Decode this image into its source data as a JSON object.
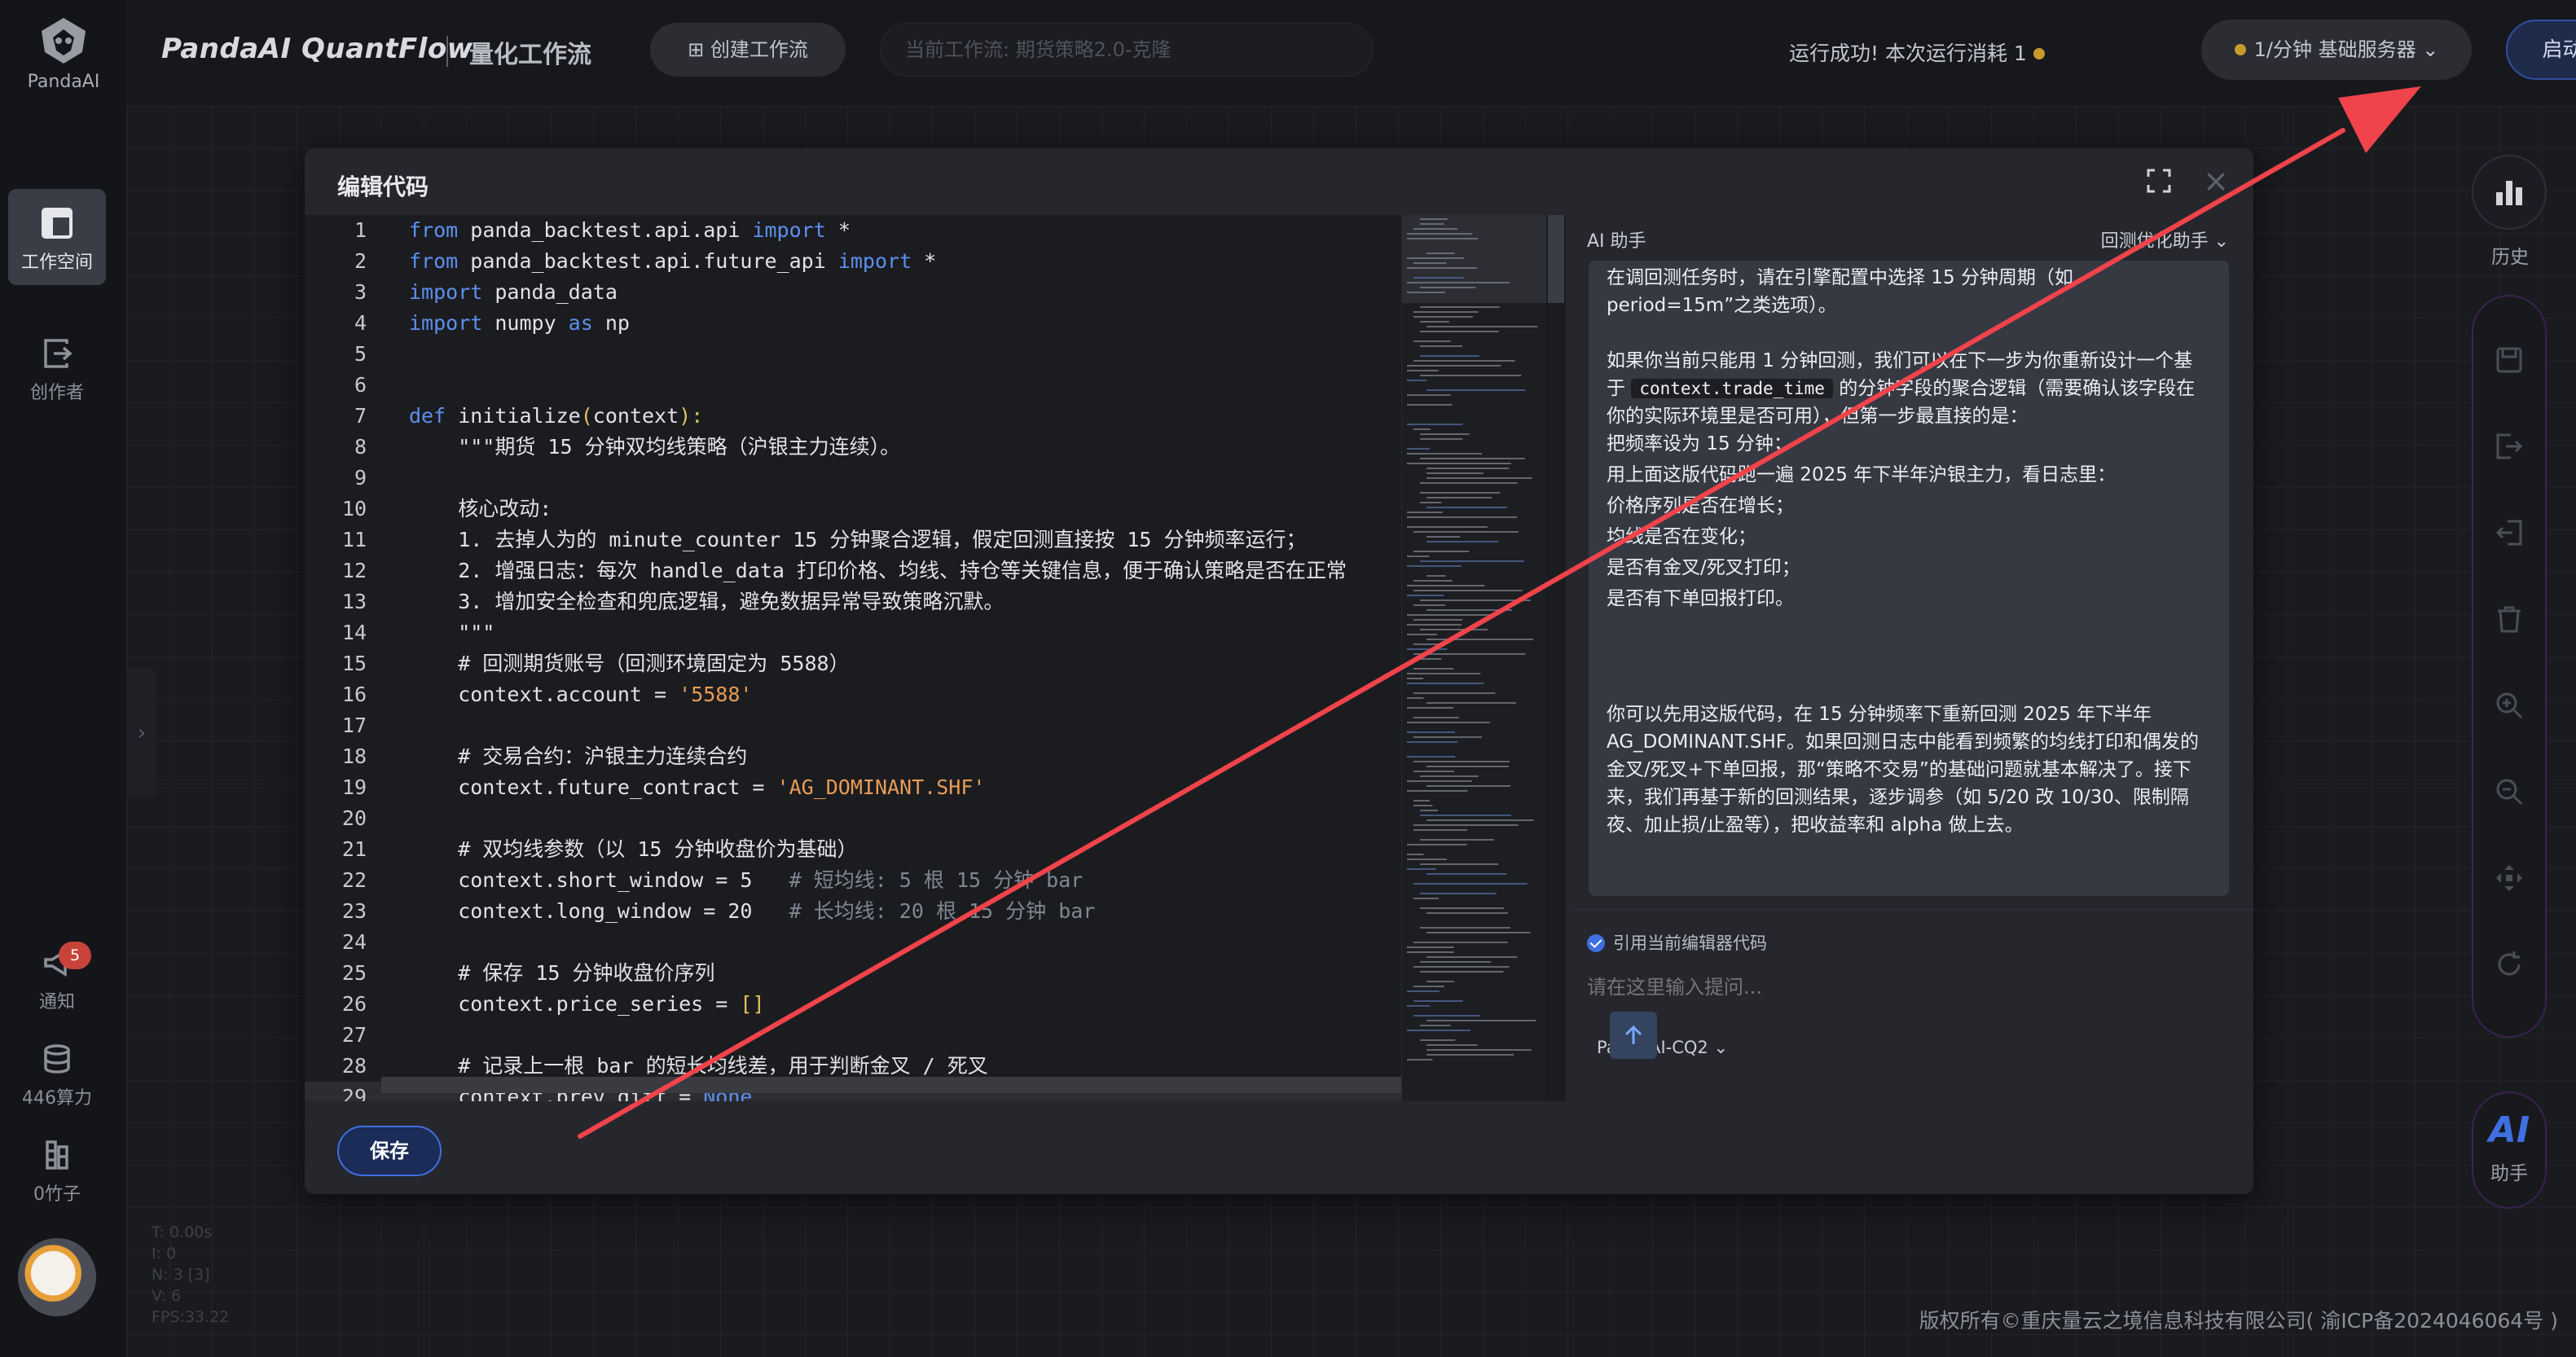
{
  "app": {
    "brand": "PandaAI QuantFlow",
    "brand_sub": "量化工作流",
    "logo_text": "PandaAI"
  },
  "topbar": {
    "create_button": "⊞ 创建工作流",
    "current_flow": "当前工作流:  期货策略2.0-克隆",
    "run_status": "运行成功!  本次运行消耗 1",
    "server_select": "1/分钟   基础服务器 ⌄",
    "start_button": "启动工作流"
  },
  "sidebar": {
    "items": [
      {
        "label": "工作空间",
        "icon": "workspace-icon"
      },
      {
        "label": "创作者",
        "icon": "creator-icon"
      },
      {
        "label": "通知",
        "icon": "megaphone-icon",
        "badge": "5"
      },
      {
        "label": "446算力",
        "icon": "database-icon"
      },
      {
        "label": "0竹子",
        "icon": "bamboo-icon"
      }
    ]
  },
  "debug": {
    "lines": [
      "T: 0.00s",
      "I: 0",
      "N: 3 [3]",
      "V: 6",
      "FPS:33.22"
    ]
  },
  "right_rail": {
    "history_label": "历史",
    "ai_mark": "AI",
    "ai_label": "助手",
    "tools": [
      "save-icon",
      "export-icon",
      "import-icon",
      "delete-icon",
      "zoom-in-icon",
      "zoom-out-icon",
      "move-icon",
      "refresh-icon"
    ]
  },
  "modal": {
    "title": "编辑代码",
    "save_button": "保存"
  },
  "editor": {
    "lines": [
      "1",
      "2",
      "3",
      "4",
      "5",
      "6",
      "7",
      "8",
      "9",
      "10",
      "11",
      "12",
      "13",
      "14",
      "15",
      "16",
      "17",
      "18",
      "19",
      "20",
      "21",
      "22",
      "23",
      "24",
      "25",
      "26",
      "27",
      "28",
      "29"
    ],
    "code": {
      "l1a": "from",
      "l1b": " panda_backtest.api.api ",
      "l1c": "import",
      "l1d": " *",
      "l2a": "from",
      "l2b": " panda_backtest.api.future_api ",
      "l2c": "import",
      "l2d": " *",
      "l3a": "import",
      "l3b": " panda_data",
      "l4a": "import",
      "l4b": " numpy ",
      "l4c": "as",
      "l4d": " np",
      "l7a": "def",
      "l7b": " initialize",
      "l7c": "(",
      "l7d": "context",
      "l7e": "):",
      "l8": "    \"\"\"期货 15 分钟双均线策略（沪银主力连续）。",
      "l10": "    核心改动:",
      "l11": "    1. 去掉人为的 minute_counter 15 分钟聚合逻辑，假定回测直接按 15 分钟频率运行；",
      "l12": "    2. 增强日志：每次 handle_data 打印价格、均线、持仓等关键信息，便于确认策略是否在正常",
      "l13": "    3. 增加安全检查和兜底逻辑，避免数据异常导致策略沉默。",
      "l14": "    \"\"\"",
      "l15": "    # 回测期货账号（回测环境固定为 5588）",
      "l16a": "    context.account = ",
      "l16b": "'5588'",
      "l18": "    # 交易合约：沪银主力连续合约",
      "l19a": "    context.future_contract = ",
      "l19b": "'AG_DOMINANT.SHF'",
      "l21": "    # 双均线参数（以 15 分钟收盘价为基础）",
      "l22a": "    context.short_window = 5   ",
      "l22b": "# 短均线: 5 根 15 分钟 bar",
      "l23a": "    context.long_window = 20   ",
      "l23b": "# 长均线: 20 根 15 分钟 bar",
      "l25": "    # 保存 15 分钟收盘价序列",
      "l26a": "    context.price_series = ",
      "l26b": "[]",
      "l28": "    # 记录上一根 bar 的短长均线差，用于判断金叉 / 死叉",
      "l29a": "    context.prev_diff = ",
      "l29b": "None"
    }
  },
  "ai_panel": {
    "title": "AI 助手",
    "mode": "回测优化助手 ⌄",
    "message": {
      "p1": "在调回测任务时，请在引擎配置中选择 15 分钟周期（如 period=15m”之类选项）。",
      "p2a": "如果你当前只能用 1 分钟回测，我们可以在下一步为你重新设计一个基于",
      "p2code": "context.trade_time",
      "p2b": "的分钟字段的聚合逻辑（需要确认该字段在你的实际环境里是否可用），但第一步最直接的是：",
      "p3": "把频率设为 15 分钟；",
      "p4": "用上面这版代码跑一遍 2025 年下半年沪银主力，看日志里：",
      "p5": "价格序列是否在增长；",
      "p6": "均线是否在变化；",
      "p7": "是否有金叉/死叉打印；",
      "p8": "是否有下单回报打印。",
      "p9": "你可以先用这版代码，在 15 分钟频率下重新回测 2025 年下半年 AG_DOMINANT.SHF。如果回测日志中能看到频繁的均线打印和偶发的金叉/死叉+下单回报，那“策略不交易”的基础问题就基本解决了。接下来，我们再基于新的回测结果，逐步调参（如 5/20 改 10/30、限制隔夜、加止损/止盈等），把收益率和 alpha 做上去。"
    },
    "ref_label": "引用当前编辑器代码",
    "input_placeholder": "请在这里输入提问...",
    "model": "PandaAI-CQ2 ⌄"
  },
  "footer": {
    "copyright": "版权所有©重庆量云之境信息科技有限公司( 渝ICP备2024046064号 )"
  },
  "colors": {
    "accent": "#3f6fe0",
    "annotation_arrow": "#f0434b",
    "keyword": "#5d8ff0",
    "string": "#e89b56",
    "comment": "#7f8792"
  }
}
